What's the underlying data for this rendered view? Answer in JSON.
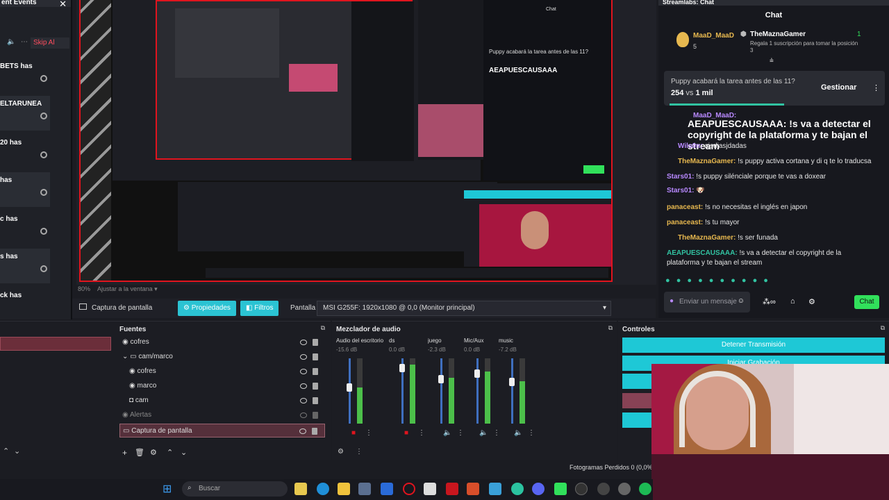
{
  "events": {
    "title": "ent Events",
    "skip_label": "Skip Al",
    "items": [
      "BETS has",
      "ELTARUNEA",
      "20 has",
      "has",
      "c has",
      "s has",
      "ck has"
    ]
  },
  "preview": {
    "zoom": "80%",
    "fit_label": "Ajustar a la ventana"
  },
  "chat": {
    "panel_title": "Streamlabs: Chat",
    "title": "Chat",
    "top_user": "MaaD_MaaD",
    "top_user_count": "5",
    "gifter": "TheMaznaGamer",
    "gifter_count": "1",
    "gifter_text": "Regala 1 suscripción para tomar la posición",
    "gifter_pos": "3",
    "poll_question": "Puppy acabará la tarea antes de las 11?",
    "poll_left": "254",
    "poll_vs": "vs",
    "poll_right": "1 mil",
    "manage_label": "Gestionar",
    "messages": [
      {
        "user": "MaaD_MaaD:",
        "text": ""
      },
      {
        "user": "AEAPUESCAUSAAA",
        "text": ": !s va a detectar el copyright de la plataforma y te bajan el stream"
      },
      {
        "user": "Wils0n:",
        "text": "ajsdjasjdadas"
      },
      {
        "user": "TheMaznaGamer:",
        "text": "!s puppy activa cortana y di q te lo traducsa"
      },
      {
        "user": "Stars01:",
        "text": "!s puppy silénciale porque te vas a doxear"
      },
      {
        "user": "Stars01:",
        "text": ""
      },
      {
        "user": "panaceast:",
        "text": "!s no necesitas el inglés en japon"
      },
      {
        "user": "panaceast:",
        "text": "!s tu mayor"
      },
      {
        "user": "TheMaznaGamer:",
        "text": "!s ser funada"
      },
      {
        "user": "AEAPUESCAUSAAA:",
        "text": "!s va a detectar el copyright de la plataforma y te bajan el stream"
      }
    ],
    "input_placeholder": "Enviar un mensaje",
    "send_label": "Chat",
    "colors": {
      "purple": "#b889ff",
      "gold": "#e7b84f",
      "teal": "#31c3a2"
    }
  },
  "propbar": {
    "source_name": "Captura de pantalla",
    "properties_label": "Propiedades",
    "filters_label": "Filtros",
    "screen_label": "Pantalla",
    "screen_value": "MSI G255F: 1920x1080 @ 0,0 (Monitor principal)"
  },
  "sources": {
    "title": "Fuentes",
    "items": [
      "cofres",
      "cam/marco",
      "cofres",
      "marco",
      "cam",
      "Alertas",
      "Captura de pantalla"
    ]
  },
  "mixer": {
    "title": "Mezclador de audio",
    "channels": [
      {
        "name": "Audio del escritorio",
        "db": "-15.6 dB",
        "level": 0.55
      },
      {
        "name": "ds",
        "db": "0.0 dB",
        "level": 0.9
      },
      {
        "name": "juego",
        "db": "-2.3 dB",
        "level": 0.7
      },
      {
        "name": "Mic/Aux",
        "db": "0.0 dB",
        "level": 0.8
      },
      {
        "name": "music",
        "db": "-7.2 dB",
        "level": 0.65
      }
    ]
  },
  "controls": {
    "title": "Controles",
    "stop_label": "Detener Transmisión",
    "record_label": "Iniciar Grabación",
    "dropped_frames": "Fotogramas Perdidos 0 (0,0%)"
  },
  "taskbar": {
    "search_label": "Buscar"
  }
}
